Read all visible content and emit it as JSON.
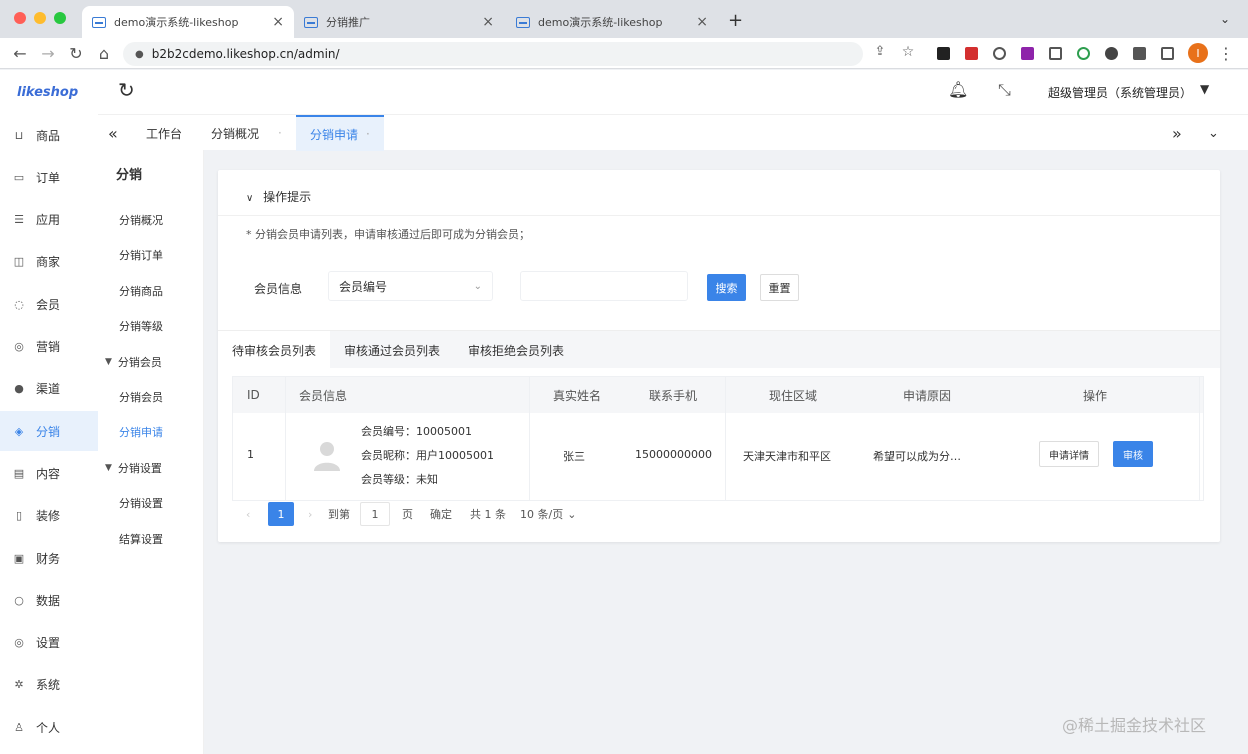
{
  "browser": {
    "tabs": [
      {
        "title": "demo演示系统-likeshop"
      },
      {
        "title": "分销推广"
      },
      {
        "title": "demo演示系统-likeshop"
      }
    ],
    "url": "b2b2cdemo.likeshop.cn/admin/",
    "profile_initial": "I",
    "profile_color": "#e8711a"
  },
  "header": {
    "logo": "likeshop",
    "user": "超级管理员（系统管理员）"
  },
  "left_nav": [
    {
      "label": "商品",
      "icon": "cart-icon"
    },
    {
      "label": "订单",
      "icon": "order-icon"
    },
    {
      "label": "应用",
      "icon": "apps-icon"
    },
    {
      "label": "商家",
      "icon": "shop-icon"
    },
    {
      "label": "会员",
      "icon": "user-icon"
    },
    {
      "label": "营销",
      "icon": "marketing-icon"
    },
    {
      "label": "渠道",
      "icon": "channel-icon"
    },
    {
      "label": "分销",
      "icon": "distribution-icon",
      "active": true
    },
    {
      "label": "内容",
      "icon": "content-icon"
    },
    {
      "label": "装修",
      "icon": "decorate-icon"
    },
    {
      "label": "财务",
      "icon": "finance-icon"
    },
    {
      "label": "数据",
      "icon": "data-icon"
    },
    {
      "label": "设置",
      "icon": "settings-icon"
    },
    {
      "label": "系统",
      "icon": "system-icon"
    },
    {
      "label": "个人",
      "icon": "person-icon"
    }
  ],
  "sub_nav": {
    "title": "分销",
    "items": [
      {
        "label": "分销概况",
        "type": "item"
      },
      {
        "label": "分销订单",
        "type": "item"
      },
      {
        "label": "分销商品",
        "type": "item"
      },
      {
        "label": "分销等级",
        "type": "item"
      },
      {
        "label": "分销会员",
        "type": "group"
      },
      {
        "label": "分销会员",
        "type": "item"
      },
      {
        "label": "分销申请",
        "type": "item",
        "active": true
      },
      {
        "label": "分销设置",
        "type": "group"
      },
      {
        "label": "分销设置",
        "type": "item"
      },
      {
        "label": "结算设置",
        "type": "item"
      }
    ]
  },
  "page_tabs": [
    "工作台",
    "分销概况",
    "分销申请"
  ],
  "tips": {
    "heading": "操作提示",
    "body": "* 分销会员申请列表，申请审核通过后即可成为分销会员；"
  },
  "filter": {
    "label": "会员信息",
    "select_value": "会员编号",
    "input_placeholder": "",
    "search_label": "搜索",
    "reset_label": "重置"
  },
  "list_tabs": [
    "待审核会员列表",
    "审核通过会员列表",
    "审核拒绝会员列表"
  ],
  "table": {
    "columns": [
      "ID",
      "会员信息",
      "真实姓名",
      "联系手机",
      "现住区域",
      "申请原因",
      "操作"
    ],
    "rows": [
      {
        "id": "1",
        "member_no": "会员编号：10005001",
        "nickname": "会员昵称：用户10005001",
        "level": "会员等级：未知",
        "real_name": "张三",
        "phone": "15000000000",
        "area": "天津天津市和平区",
        "reason": "希望可以成为分…",
        "detail_label": "申请详情",
        "audit_label": "审核"
      }
    ]
  },
  "pager": {
    "current": "1",
    "goto_label": "到第",
    "goto_value": "1",
    "page_unit": "页",
    "confirm_label": "确定",
    "total": "共 1 条",
    "size": "10 条/页"
  },
  "watermark": "@稀土掘金技术社区",
  "accent": "#3a84e8"
}
